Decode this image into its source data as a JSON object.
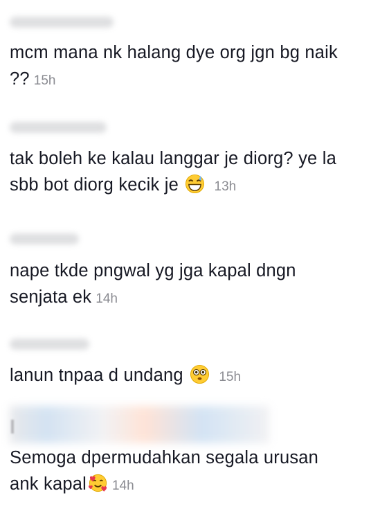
{
  "comments": [
    {
      "text": "mcm mana nk halang dye org jgn bg naik ??",
      "time": "15h",
      "emoji": ""
    },
    {
      "text": "tak boleh ke kalau langgar je diorg? ye la sbb bot diorg kecik je",
      "time": "13h",
      "emoji": "grinning-sweat-emoji"
    },
    {
      "text": "nape tkde pngwal yg jga kapal dngn senjata ek",
      "time": "14h",
      "emoji": ""
    },
    {
      "text": "lanun tnpaa d undang",
      "time": "15h",
      "emoji": "flushed-face-emoji"
    },
    {
      "text": "Semoga dpermudahkan segala urusan ank kapal",
      "time": "14h",
      "emoji": "smiling-face-with-hearts-emoji"
    }
  ]
}
